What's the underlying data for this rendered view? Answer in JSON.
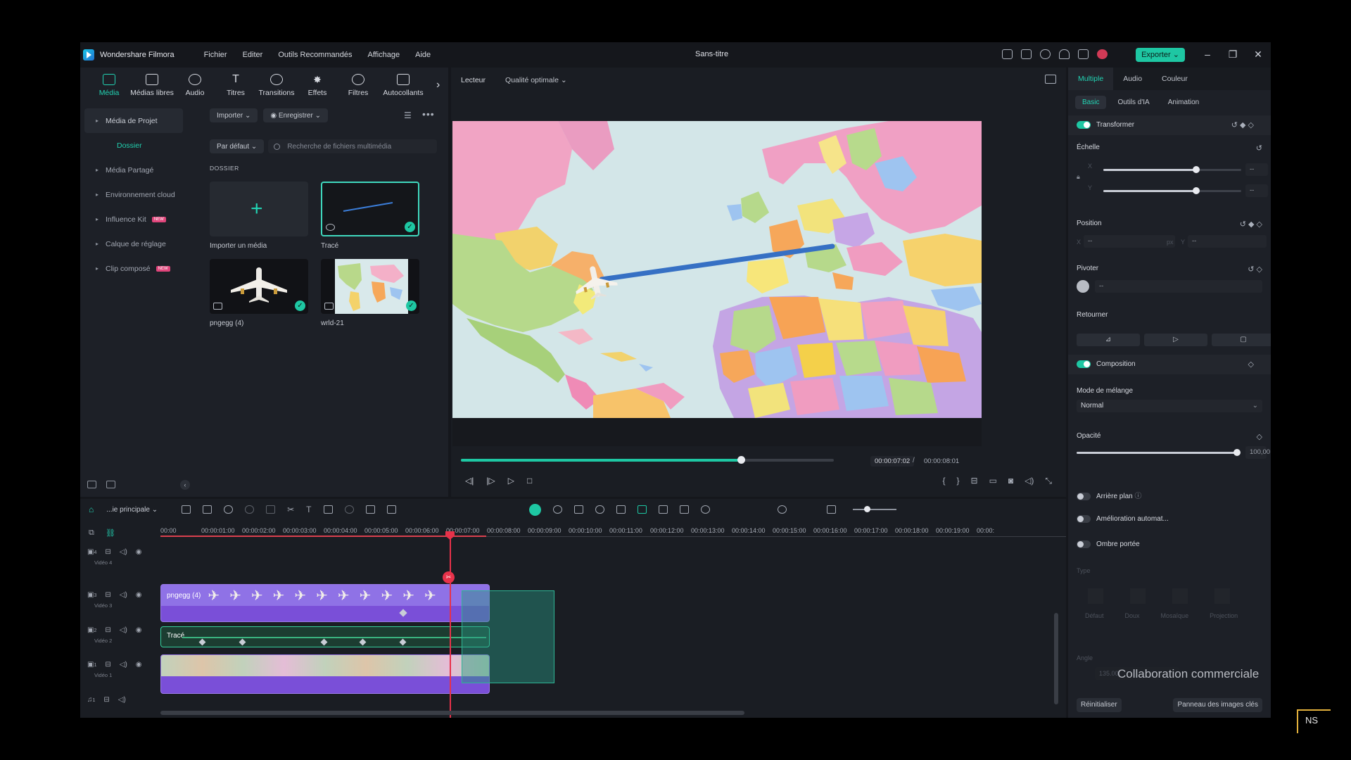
{
  "titlebar": {
    "app_name": "Wondershare Filmora",
    "menu": [
      "Fichier",
      "Editer",
      "Outils Recommandés",
      "Affichage",
      "Aide"
    ],
    "doc_title": "Sans-titre",
    "export_label": "Exporter ⌄",
    "window_controls": [
      "–",
      "❐",
      "✕"
    ]
  },
  "tool_tabs": [
    "Média",
    "Médias libres",
    "Audio",
    "Titres",
    "Transitions",
    "Effets",
    "Filtres",
    "Autocollants"
  ],
  "sidebar": {
    "items": [
      {
        "label": "Média de Projet"
      },
      {
        "label": "Dossier"
      },
      {
        "label": "Média Partagé"
      },
      {
        "label": "Environnement cloud"
      },
      {
        "label": "Influence Kit",
        "badge": "NEW"
      },
      {
        "label": "Calque de réglage"
      },
      {
        "label": "Clip composé",
        "badge": "NEW"
      }
    ]
  },
  "media": {
    "import_label": "Importer ⌄",
    "record_label": "◉ Enregistrer ⌄",
    "sort_label": "Par défaut ⌄",
    "search_placeholder": "Recherche de fichiers multimédia",
    "section": "DOSSIER",
    "items": [
      {
        "label": "Importer un média"
      },
      {
        "label": "Tracé"
      },
      {
        "label": "pngegg (4)"
      },
      {
        "label": "wrld-21"
      }
    ]
  },
  "preview": {
    "player_label": "Lecteur",
    "quality_label": "Qualité optimale ⌄",
    "time_current": "00:00:07:02",
    "time_separator": "/",
    "time_total": "00:00:08:01",
    "progress": 0.75
  },
  "props": {
    "tabs": [
      "Multiple",
      "Audio",
      "Couleur"
    ],
    "subtabs": [
      "Basic",
      "Outils d'IA",
      "Animation"
    ],
    "transform": "Transformer",
    "scale": "Échelle",
    "scale_x_label": "X",
    "scale_y_label": "Y",
    "scale_x_value": "--",
    "scale_y_value": "--",
    "percent": "%",
    "position": "Position",
    "pos_x_label": "X",
    "pos_y_label": "Y",
    "pos_x_value": "--",
    "pos_y_value": "--",
    "px": "px",
    "rotate": "Pivoter",
    "rotate_value": "--",
    "flip": "Retourner",
    "composition": "Composition",
    "blend_label": "Mode de mélange",
    "blend_value": "Normal",
    "opacity_label": "Opacité",
    "opacity_value": "100,00",
    "opacity": 1.0,
    "background": "Arrière plan",
    "auto_enhance": "Amélioration automat...",
    "drop_shadow": "Ombre portée",
    "type_label": "Type",
    "type_options": [
      "Défaut",
      "Doux",
      "Mosaïque",
      "Projection"
    ],
    "angle_label": "Angle",
    "angle_value": "135.00",
    "reset_label": "Réinitialiser",
    "keyframe_panel_label": "Panneau des images clés",
    "accent": "#1ec7a3"
  },
  "timeline": {
    "track_main": "...ie principale ⌄",
    "ruler_labels": [
      "00:00",
      "00:00:01:00",
      "00:00:02:00",
      "00:00:03:00",
      "00:00:04:00",
      "00:00:05:00",
      "00:00:06:00",
      "00:00:07:00",
      "00:00:08:00",
      "00:00:09:00",
      "00:00:10:00",
      "00:00:11:00",
      "00:00:12:00",
      "00:00:13:00",
      "00:00:14:00",
      "00:00:15:00",
      "00:00:16:00",
      "00:00:17:00",
      "00:00:18:00",
      "00:00:19:00",
      "00:00:"
    ],
    "tracks": [
      {
        "label": "Vidéo 4",
        "num": "4"
      },
      {
        "label": "Vidéo 3",
        "num": "3"
      },
      {
        "label": "Vidéo 2",
        "num": "2"
      },
      {
        "label": "Vidéo 1",
        "num": "1"
      },
      {
        "label": "",
        "num": "1"
      }
    ],
    "clips": [
      {
        "label": "pngegg (4)"
      },
      {
        "label": "Tracé"
      }
    ]
  },
  "watermark": "Collaboration commerciale",
  "corner_mark": "NS"
}
